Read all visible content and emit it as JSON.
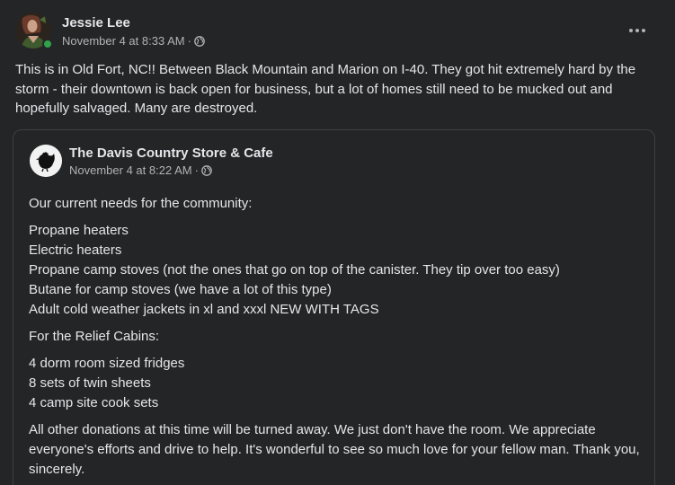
{
  "post": {
    "author": "Jessie Lee",
    "timestamp": "November 4 at 8:33 AM",
    "separator": "·",
    "body": "This is in Old Fort, NC!! Between Black Mountain and Marion on I-40. They got hit extremely hard by the storm - their downtown is back open for business, but a lot of homes still need to be mucked out and hopefully salvaged. Many are destroyed.",
    "privacy_icon": "globe-icon",
    "more_icon": "more-options-icon"
  },
  "shared": {
    "page_name": "The Davis Country Store & Cafe",
    "timestamp": "November 4 at 8:22 AM",
    "separator": "·",
    "privacy_icon": "globe-icon",
    "intro": "Our current needs for the community:",
    "needs": [
      "Propane heaters",
      "Electric heaters",
      "Propane camp stoves (not the ones that go on top of the canister.  They tip over too easy)",
      "Butane for camp stoves (we have a lot of this type)",
      "Adult cold weather jackets in xl and xxxl NEW WITH TAGS"
    ],
    "cabins_heading": "For the Relief Cabins:",
    "cabins": [
      "4 dorm room sized fridges",
      "8 sets of twin sheets",
      "4 camp site cook sets"
    ],
    "closing": "All other donations at this time will be turned away. We just don't have the room. We appreciate everyone's efforts and drive to help. It's wonderful to see so much love for your fellow man. Thank you, sincerely."
  },
  "colors": {
    "background": "#242526",
    "text_primary": "#e4e6eb",
    "text_secondary": "#b0b3b8",
    "online": "#31a24c",
    "border": "#3e4042"
  }
}
